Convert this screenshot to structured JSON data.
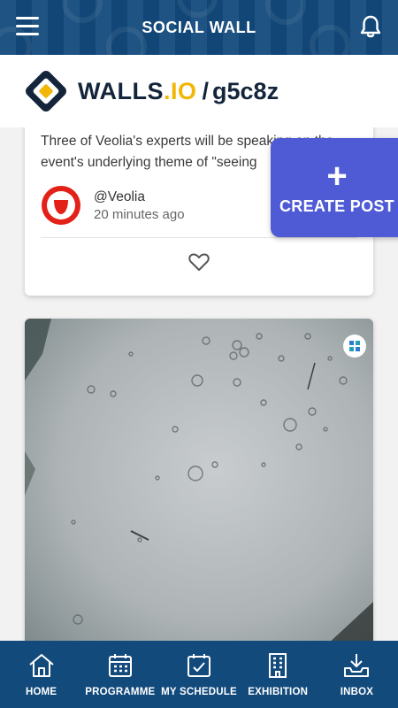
{
  "header": {
    "title": "SOCIAL WALL",
    "menu_icon": "hamburger-menu-icon",
    "notification_icon": "bell-icon"
  },
  "brand": {
    "name_main": "WALLS",
    "name_dot": ".IO",
    "slash": "/",
    "handle": "g5c8z",
    "accent_color": "#f2b705"
  },
  "posts": [
    {
      "text": "Three of Veolia's experts will be speaking on the event's underlying theme of \"seeing",
      "author": "@Veolia",
      "time": "20 minutes ago",
      "like_icon": "heart-icon"
    },
    {
      "media": "raindrops-on-glass-photo",
      "source_icon": "walls-io-badge-icon"
    }
  ],
  "fab": {
    "plus": "+",
    "label": "CREATE POST",
    "color": "#4f5bd5"
  },
  "nav": [
    {
      "label": "HOME",
      "icon": "home-icon"
    },
    {
      "label": "PROGRAMME",
      "icon": "calendar-icon"
    },
    {
      "label": "MY SCHEDULE",
      "icon": "calendar-check-icon"
    },
    {
      "label": "EXHIBITION",
      "icon": "building-icon"
    },
    {
      "label": "INBOX",
      "icon": "inbox-download-icon"
    }
  ],
  "colors": {
    "primary": "#134a7c"
  }
}
